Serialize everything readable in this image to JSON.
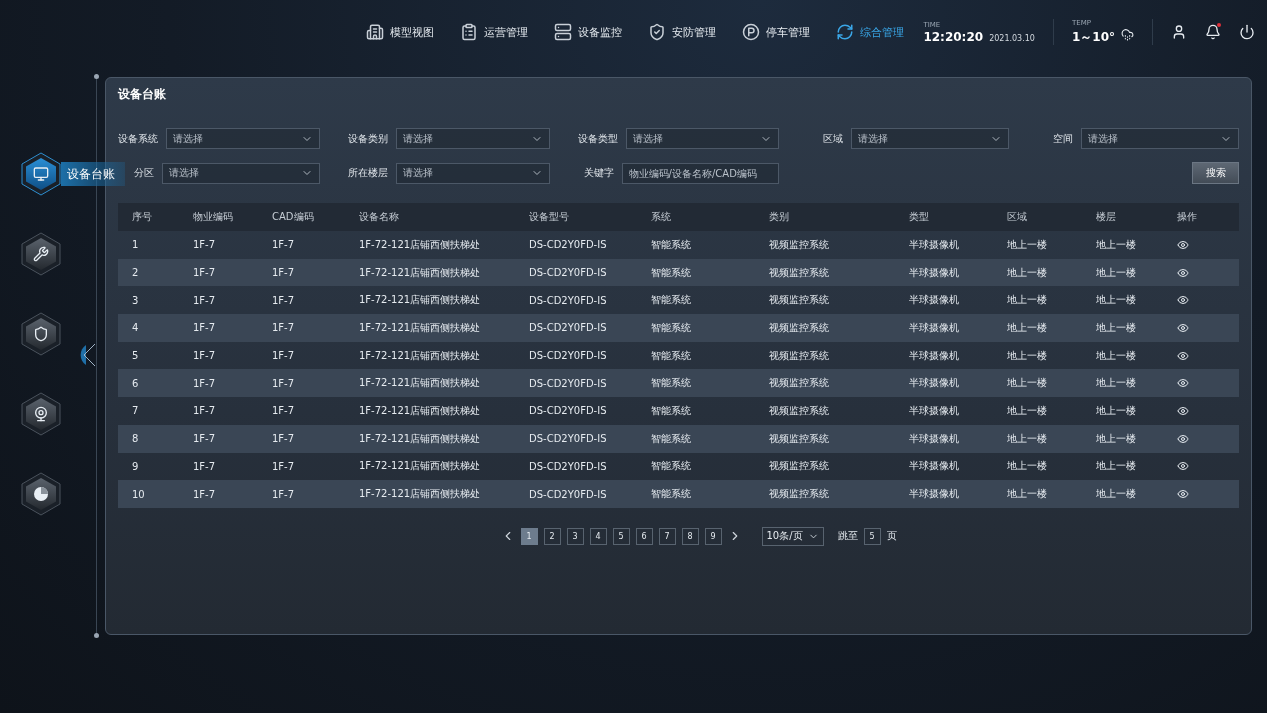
{
  "top_nav": [
    {
      "label": "模型视图",
      "selected": false
    },
    {
      "label": "运营管理",
      "selected": false
    },
    {
      "label": "设备监控",
      "selected": false
    },
    {
      "label": "安防管理",
      "selected": false
    },
    {
      "label": "停车管理",
      "selected": false
    },
    {
      "label": "综合管理",
      "selected": true
    }
  ],
  "status": {
    "time_label": "TIME",
    "time": "12:20:20",
    "date": "2021.03.10",
    "temp_label": "TEMP",
    "temp": "1～10°",
    "has_unread": true
  },
  "side_nav": [
    {
      "label": "设备台账",
      "selected": true
    },
    {
      "selected": false
    },
    {
      "selected": false
    },
    {
      "selected": false
    },
    {
      "selected": false
    }
  ],
  "panel": {
    "title": "设备台账",
    "filters": [
      {
        "label": "设备系统",
        "kind": "select",
        "placeholder": "请选择"
      },
      {
        "label": "设备类别",
        "kind": "select",
        "placeholder": "请选择"
      },
      {
        "label": "设备类型",
        "kind": "select",
        "placeholder": "请选择"
      },
      {
        "label": "区域",
        "kind": "select",
        "placeholder": "请选择"
      },
      {
        "label": "空间",
        "kind": "select",
        "placeholder": "请选择"
      },
      {
        "label": "分区",
        "kind": "select",
        "placeholder": "请选择"
      },
      {
        "label": "所在楼层",
        "kind": "select",
        "placeholder": "请选择"
      },
      {
        "label": "关键字",
        "kind": "input",
        "placeholder": "物业编码/设备名称/CAD编码"
      }
    ],
    "search_button": "搜索",
    "table": {
      "columns": [
        "序号",
        "物业编码",
        "CAD编码",
        "设备名称",
        "设备型号",
        "系统",
        "类别",
        "类型",
        "区域",
        "楼层",
        "操作"
      ],
      "rows": [
        [
          "1",
          "1F-7",
          "1F-7",
          "1F-72-121店铺西侧扶梯处",
          "DS-CD2Y0FD-IS",
          "智能系统",
          "视频监控系统",
          "半球摄像机",
          "地上一楼",
          "地上一楼"
        ],
        [
          "2",
          "1F-7",
          "1F-7",
          "1F-72-121店铺西侧扶梯处",
          "DS-CD2Y0FD-IS",
          "智能系统",
          "视频监控系统",
          "半球摄像机",
          "地上一楼",
          "地上一楼"
        ],
        [
          "3",
          "1F-7",
          "1F-7",
          "1F-72-121店铺西侧扶梯处",
          "DS-CD2Y0FD-IS",
          "智能系统",
          "视频监控系统",
          "半球摄像机",
          "地上一楼",
          "地上一楼"
        ],
        [
          "4",
          "1F-7",
          "1F-7",
          "1F-72-121店铺西侧扶梯处",
          "DS-CD2Y0FD-IS",
          "智能系统",
          "视频监控系统",
          "半球摄像机",
          "地上一楼",
          "地上一楼"
        ],
        [
          "5",
          "1F-7",
          "1F-7",
          "1F-72-121店铺西侧扶梯处",
          "DS-CD2Y0FD-IS",
          "智能系统",
          "视频监控系统",
          "半球摄像机",
          "地上一楼",
          "地上一楼"
        ],
        [
          "6",
          "1F-7",
          "1F-7",
          "1F-72-121店铺西侧扶梯处",
          "DS-CD2Y0FD-IS",
          "智能系统",
          "视频监控系统",
          "半球摄像机",
          "地上一楼",
          "地上一楼"
        ],
        [
          "7",
          "1F-7",
          "1F-7",
          "1F-72-121店铺西侧扶梯处",
          "DS-CD2Y0FD-IS",
          "智能系统",
          "视频监控系统",
          "半球摄像机",
          "地上一楼",
          "地上一楼"
        ],
        [
          "8",
          "1F-7",
          "1F-7",
          "1F-72-121店铺西侧扶梯处",
          "DS-CD2Y0FD-IS",
          "智能系统",
          "视频监控系统",
          "半球摄像机",
          "地上一楼",
          "地上一楼"
        ],
        [
          "9",
          "1F-7",
          "1F-7",
          "1F-72-121店铺西侧扶梯处",
          "DS-CD2Y0FD-IS",
          "智能系统",
          "视频监控系统",
          "半球摄像机",
          "地上一楼",
          "地上一楼"
        ],
        [
          "10",
          "1F-7",
          "1F-7",
          "1F-72-121店铺西侧扶梯处",
          "DS-CD2Y0FD-IS",
          "智能系统",
          "视频监控系统",
          "半球摄像机",
          "地上一楼",
          "地上一楼"
        ]
      ]
    },
    "pagination": {
      "pages": [
        {
          "label": "1",
          "selected": true
        },
        {
          "label": "2",
          "selected": false
        },
        {
          "label": "3",
          "selected": false
        },
        {
          "label": "4",
          "selected": false
        },
        {
          "label": "5",
          "selected": false
        },
        {
          "label": "6",
          "selected": false
        },
        {
          "label": "7",
          "selected": false
        },
        {
          "label": "8",
          "selected": false
        },
        {
          "label": "9",
          "selected": false
        }
      ],
      "page_size": "10条/页",
      "jump_label": "跳至",
      "jump_value": "5",
      "page_unit": "页"
    }
  }
}
